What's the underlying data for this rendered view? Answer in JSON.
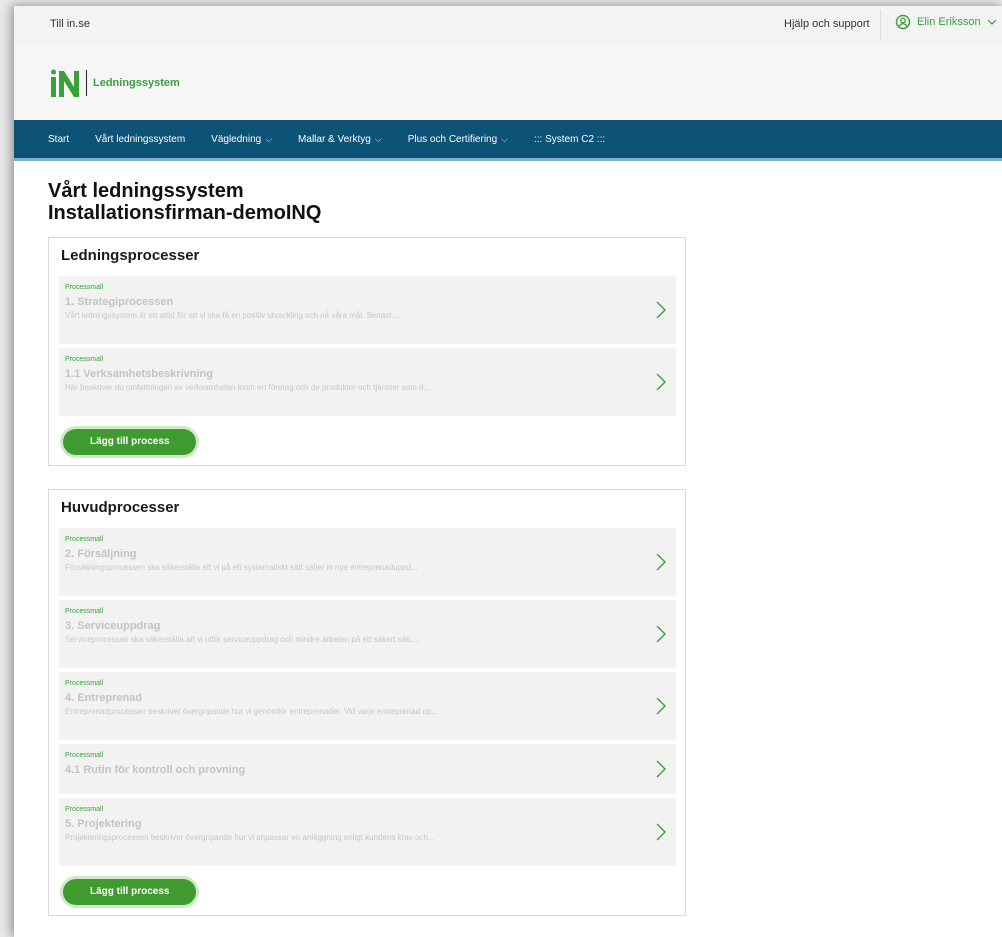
{
  "utility": {
    "till_link": "Till in.se",
    "help_link": "Hjälp och support",
    "user_name": "Elin Eriksson"
  },
  "brand": {
    "app_name": "Ledningssystem",
    "accent_color": "#3aa13a",
    "nav_color": "#0d5277"
  },
  "nav": {
    "items": [
      {
        "label": "Start",
        "dropdown": false
      },
      {
        "label": "Vårt ledningssystem",
        "dropdown": false
      },
      {
        "label": "Vägledning",
        "dropdown": true
      },
      {
        "label": "Mallar & Verktyg",
        "dropdown": true
      },
      {
        "label": "Plus och Certifiering",
        "dropdown": true
      },
      {
        "label": "::: System C2 :::",
        "dropdown": false
      }
    ]
  },
  "page": {
    "title_line1": "Vårt ledningssystem",
    "title_line2": "Installationsfirman-demoINQ"
  },
  "sections": [
    {
      "title": "Ledningsprocesser",
      "add_label": "Lägg till process",
      "processes": [
        {
          "tag": "Processmall",
          "name": "1. Strategiprocessen",
          "desc": "Vårt ledningssystem är ett stöd för att vi ska få en positiv utveckling och nå våra mål. Senast ..."
        },
        {
          "tag": "Processmall",
          "name": "1.1 Verksamhetsbeskrivning",
          "desc": "Här beskriver du omfattningen av verksamheten inom ert företag och de produkter och tjänster som ri..."
        }
      ]
    },
    {
      "title": "Huvudprocesser",
      "add_label": "Lägg till process",
      "processes": [
        {
          "tag": "Processmall",
          "name": "2. Försäljning",
          "desc": "Försäljningsprocessen ska säkerställa att vi på ett systematiskt sätt säljer in nya entreprenaduppd..."
        },
        {
          "tag": "Processmall",
          "name": "3. Serviceuppdrag",
          "desc": "Serviceprocessen ska säkerställa att vi utför serviceuppdrag och mindre arbeten på ett säkert sätt...."
        },
        {
          "tag": "Processmall",
          "name": "4. Entreprenad",
          "desc": "Entreprenadprocessen beskriver övergripande hur vi genomför entreprenader. Vid varje entreprenad up..."
        },
        {
          "tag": "Processmall",
          "name": "4.1 Rutin för kontroll och provning",
          "desc": ""
        },
        {
          "tag": "Processmall",
          "name": "5. Projektering",
          "desc": "Projekteringsprocessen beskriver övergripande hur vi anpassar en anläggning enligt kundens krav och..."
        }
      ]
    }
  ]
}
